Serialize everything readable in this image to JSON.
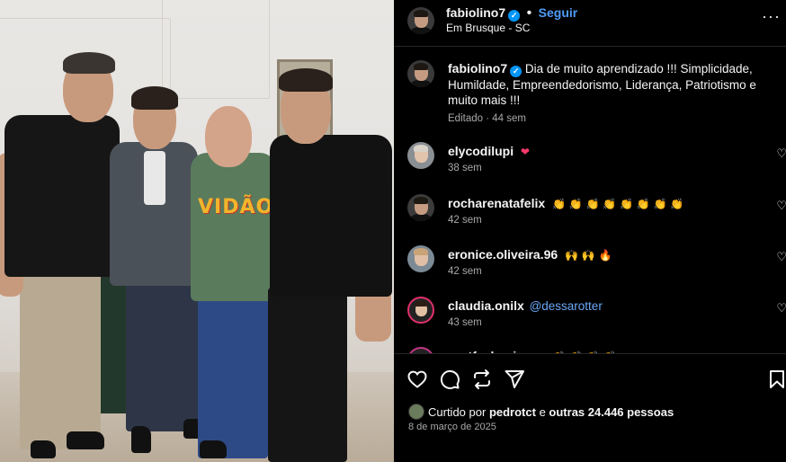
{
  "post": {
    "username": "fabiolino7",
    "follow_label": "Seguir",
    "location": "Em Brusque - SC",
    "more_label": "···"
  },
  "caption": {
    "username": "fabiolino7",
    "text": "Dia de muito aprendizado !!! Simplicidade, Humildade, Empreendedorismo, Liderança, Patriotismo e muito mais !!!",
    "meta": "Editado · 44 sem"
  },
  "photo": {
    "shirt_print": "VIDÃO"
  },
  "comments": [
    {
      "username": "elycodilupi",
      "text": "❤",
      "time": "38 sem"
    },
    {
      "username": "rocharenatafelix",
      "text": "👏 👏 👏 👏 👏 👏 👏 👏",
      "time": "42 sem"
    },
    {
      "username": "eronice.oliveira.96",
      "text": "🙌 🙌 🔥",
      "time": "42 sem"
    },
    {
      "username": "claudia.onilx",
      "mention": "@dessarotter",
      "time": "43 sem"
    },
    {
      "username": "portfasbusiness",
      "text": "👏 👏 👏 👏",
      "time": ""
    }
  ],
  "likes": {
    "prefix": "Curtido por",
    "user": "pedrotct",
    "middle": "e",
    "others": "outras 24.446 pessoas"
  },
  "date": "8 de março de 2025",
  "icons": {
    "like": "heart-icon",
    "comment": "comment-icon",
    "share": "repost-icon",
    "send": "send-icon",
    "save": "bookmark-icon"
  },
  "colors": {
    "background": "#000000",
    "link": "#4f9cf6",
    "verified": "#0095f6",
    "muted": "#a8a8a8"
  }
}
